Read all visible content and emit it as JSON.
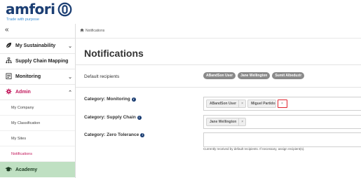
{
  "brand": {
    "name": "amfori",
    "tagline": "Trade with purpose",
    "color": "#1b3e73"
  },
  "sidebar": {
    "collapse_label": "«",
    "items": [
      {
        "label": "My Sustainability",
        "icon": "leaf-icon",
        "chevron": "⌄"
      },
      {
        "label": "Supply Chain Mapping",
        "icon": "org-chart-icon",
        "chevron": ""
      },
      {
        "label": "Monitoring",
        "icon": "clipboard-icon",
        "chevron": "⌄"
      },
      {
        "label": "Admin",
        "icon": "gear-icon",
        "chevron": "⌃"
      }
    ],
    "admin_sub_items": [
      {
        "label": "My Company"
      },
      {
        "label": "My Classification"
      },
      {
        "label": "My Sites"
      },
      {
        "label": "Notifications"
      }
    ],
    "academy": {
      "label": "Academy",
      "icon": "graduation-cap-icon"
    }
  },
  "breadcrumb": {
    "label": "Notifications",
    "icon": "home-icon"
  },
  "page": {
    "title": "Notifications"
  },
  "rows": {
    "default": {
      "label": "Default recipients",
      "recipients": [
        "ABandSon User",
        "Jane Wellington",
        "Sumit Albeduzir"
      ]
    },
    "monitoring": {
      "label": "Category: Monitoring",
      "tags": [
        "ABandSon User",
        "Miguel Partido"
      ]
    },
    "supply_chain": {
      "label": "Category: Supply Chain",
      "tags": [
        "Jane Wellington"
      ]
    },
    "zero_tolerance": {
      "label": "Category: Zero Tolerance",
      "tags": [],
      "help": "Currently received by default recipients. If necessary, assign recipient(s)."
    }
  },
  "tag_remove_symbol": "×",
  "info_symbol": "i",
  "colors": {
    "admin_accent": "#c2185b",
    "academy_bg": "#bfe0c2",
    "highlight": "#e0242f"
  }
}
